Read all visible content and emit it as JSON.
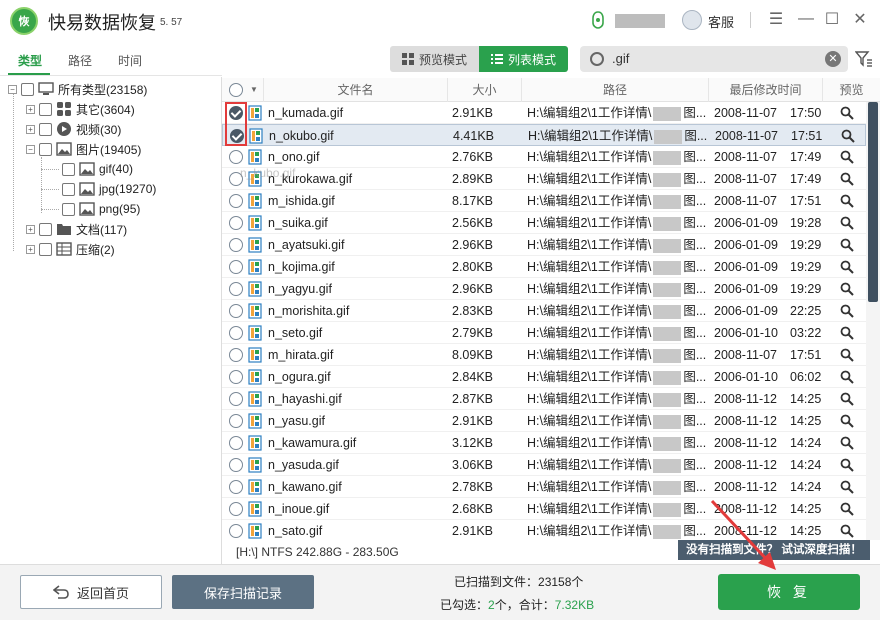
{
  "app": {
    "title": "快易数据恢复",
    "version": "5. 57",
    "service_label": "客服"
  },
  "left_tabs": [
    "类型",
    "路径",
    "时间"
  ],
  "tree": [
    {
      "label": "所有类型(23158)"
    },
    {
      "label": "其它(3604)"
    },
    {
      "label": "视频(30)"
    },
    {
      "label": "图片(19405)"
    },
    {
      "label": "gif(40)"
    },
    {
      "label": "jpg(19270)"
    },
    {
      "label": "png(95)"
    },
    {
      "label": "文档(117)"
    },
    {
      "label": "压缩(2)"
    }
  ],
  "view_modes": {
    "preview": "预览模式",
    "list": "列表模式"
  },
  "search": {
    "value": ".gif"
  },
  "columns": [
    "文件名",
    "大小",
    "路径",
    "最后修改时间",
    "预览"
  ],
  "rows": [
    {
      "name": "n_kumada.gif",
      "size": "2.91KB",
      "path_a": "H:\\编辑组2\\1工作详情\\",
      "path_b": "图...",
      "date": "2008-11-07",
      "time": "17:50",
      "checked": true
    },
    {
      "name": "n_okubo.gif",
      "size": "4.41KB",
      "path_a": "H:\\编辑组2\\1工作详情\\",
      "path_b": "图...",
      "date": "2008-11-07",
      "time": "17:51",
      "checked": true
    },
    {
      "name": "n_ono.gif",
      "size": "2.76KB",
      "path_a": "H:\\编辑组2\\1工作详情\\",
      "path_b": "图...",
      "date": "2008-11-07",
      "time": "17:49",
      "checked": false
    },
    {
      "name": "n_kurokawa.gif",
      "size": "2.89KB",
      "path_a": "H:\\编辑组2\\1工作详情\\",
      "path_b": "图...",
      "date": "2008-11-07",
      "time": "17:49",
      "checked": false
    },
    {
      "name": "m_ishida.gif",
      "size": "8.17KB",
      "path_a": "H:\\编辑组2\\1工作详情\\",
      "path_b": "图...",
      "date": "2008-11-07",
      "time": "17:51",
      "checked": false
    },
    {
      "name": "n_suika.gif",
      "size": "2.56KB",
      "path_a": "H:\\编辑组2\\1工作详情\\",
      "path_b": "图...",
      "date": "2006-01-09",
      "time": "19:28",
      "checked": false
    },
    {
      "name": "n_ayatsuki.gif",
      "size": "2.96KB",
      "path_a": "H:\\编辑组2\\1工作详情\\",
      "path_b": "图...",
      "date": "2006-01-09",
      "time": "19:29",
      "checked": false
    },
    {
      "name": "n_kojima.gif",
      "size": "2.80KB",
      "path_a": "H:\\编辑组2\\1工作详情\\",
      "path_b": "图...",
      "date": "2006-01-09",
      "time": "19:29",
      "checked": false
    },
    {
      "name": "n_yagyu.gif",
      "size": "2.96KB",
      "path_a": "H:\\编辑组2\\1工作详情\\",
      "path_b": "图...",
      "date": "2006-01-09",
      "time": "19:29",
      "checked": false
    },
    {
      "name": "n_morishita.gif",
      "size": "2.83KB",
      "path_a": "H:\\编辑组2\\1工作详情\\",
      "path_b": "图...",
      "date": "2006-01-09",
      "time": "22:25",
      "checked": false
    },
    {
      "name": "n_seto.gif",
      "size": "2.79KB",
      "path_a": "H:\\编辑组2\\1工作详情\\",
      "path_b": "图...",
      "date": "2006-01-10",
      "time": "03:22",
      "checked": false
    },
    {
      "name": "m_hirata.gif",
      "size": "8.09KB",
      "path_a": "H:\\编辑组2\\1工作详情\\",
      "path_b": "图...",
      "date": "2008-11-07",
      "time": "17:51",
      "checked": false
    },
    {
      "name": "n_ogura.gif",
      "size": "2.84KB",
      "path_a": "H:\\编辑组2\\1工作详情\\",
      "path_b": "图...",
      "date": "2006-01-10",
      "time": "06:02",
      "checked": false
    },
    {
      "name": "n_hayashi.gif",
      "size": "2.87KB",
      "path_a": "H:\\编辑组2\\1工作详情\\",
      "path_b": "图...",
      "date": "2008-11-12",
      "time": "14:25",
      "checked": false
    },
    {
      "name": "n_yasu.gif",
      "size": "2.91KB",
      "path_a": "H:\\编辑组2\\1工作详情\\",
      "path_b": "图...",
      "date": "2008-11-12",
      "time": "14:25",
      "checked": false
    },
    {
      "name": "n_kawamura.gif",
      "size": "3.12KB",
      "path_a": "H:\\编辑组2\\1工作详情\\",
      "path_b": "图...",
      "date": "2008-11-12",
      "time": "14:24",
      "checked": false
    },
    {
      "name": "n_yasuda.gif",
      "size": "3.06KB",
      "path_a": "H:\\编辑组2\\1工作详情\\",
      "path_b": "图...",
      "date": "2008-11-12",
      "time": "14:24",
      "checked": false
    },
    {
      "name": "n_kawano.gif",
      "size": "2.78KB",
      "path_a": "H:\\编辑组2\\1工作详情\\",
      "path_b": "图...",
      "date": "2008-11-12",
      "time": "14:24",
      "checked": false
    },
    {
      "name": "n_inoue.gif",
      "size": "2.68KB",
      "path_a": "H:\\编辑组2\\1工作详情\\",
      "path_b": "图...",
      "date": "2008-11-12",
      "time": "14:25",
      "checked": false
    },
    {
      "name": "n_sato.gif",
      "size": "2.91KB",
      "path_a": "H:\\编辑组2\\1工作详情\\",
      "path_b": "图...",
      "date": "2008-11-12",
      "time": "14:25",
      "checked": false
    }
  ],
  "watermark": "n_kubo.gif",
  "status": {
    "path": "[H:\\] NTFS 242.88G - 283.50G",
    "deep_scan": "没有扫描到文件？ 试试深度扫描！"
  },
  "bottom": {
    "home_label": "返回首页",
    "save_label": "保存扫描记录",
    "scanned_prefix": "已扫描到文件：",
    "scanned_count": "23158个",
    "selected_prefix": "已勾选：",
    "selected_count": "2",
    "selected_unit": "个，合计：",
    "selected_size": "7.32KB",
    "recover_label": "恢 复"
  },
  "colors": {
    "accent": "#2aa14d",
    "dark": "#4b5d6e",
    "highlight": "#e23b3b"
  },
  "icons": {
    "user": "user-icon",
    "service": "headset-icon",
    "menu": "menu-icon",
    "minimize": "minimize-icon",
    "maximize": "maximize-icon",
    "close": "close-icon",
    "search": "search-icon",
    "filter": "filter-icon",
    "preview": "magnifier-icon"
  }
}
